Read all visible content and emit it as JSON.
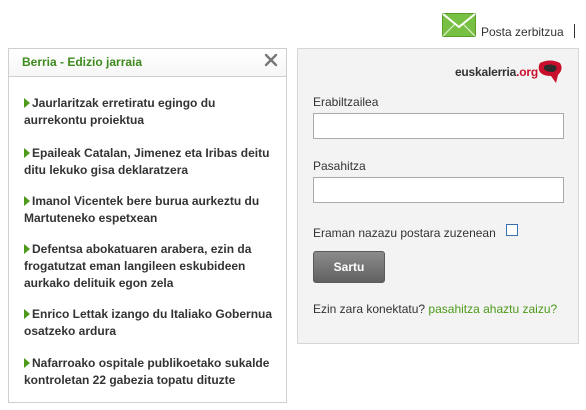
{
  "topbar": {
    "mail_icon": "envelope-icon",
    "posta_link": "Posta zerbitzua"
  },
  "news": {
    "title": "Berria - Edizio jarraia",
    "close_icon": "close-icon",
    "items": [
      "Jaurlaritzak erretiratu egingo du aurrekontu proiektua",
      "Epaileak Catalan, Jimenez eta Iribas deitu ditu lekuko gisa deklaratzera",
      "Imanol Vicentek bere burua aurkeztu du Martuteneko espetxean",
      "Defentsa abokatuaren arabera, ezin da frogatutzat eman langileen eskubideen aurkako delituik egon zela",
      "Enrico Lettak izango du Italiako Gobernua osatzeko ardura",
      "Nafarroako ospitale publikoetako sukalde kontroletan 22 gabezia topatu dituzte"
    ]
  },
  "login": {
    "logo": {
      "name": "euskalerria",
      "tld": ".org"
    },
    "username_label": "Erabiltzailea",
    "username_value": "",
    "password_label": "Pasahitza",
    "password_value": "",
    "remember_label": "Eraman nazazu postara zuzenean",
    "submit_label": "Sartu",
    "forgot_prefix": "Ezin zara konektatu?",
    "forgot_link": "pasahitza ahaztu zaizu?"
  },
  "colors": {
    "accent_green": "#4d9a1a",
    "title_green": "#3d8a1d",
    "logo_red": "#c8102e",
    "button_gray": "#6f6f6f"
  }
}
